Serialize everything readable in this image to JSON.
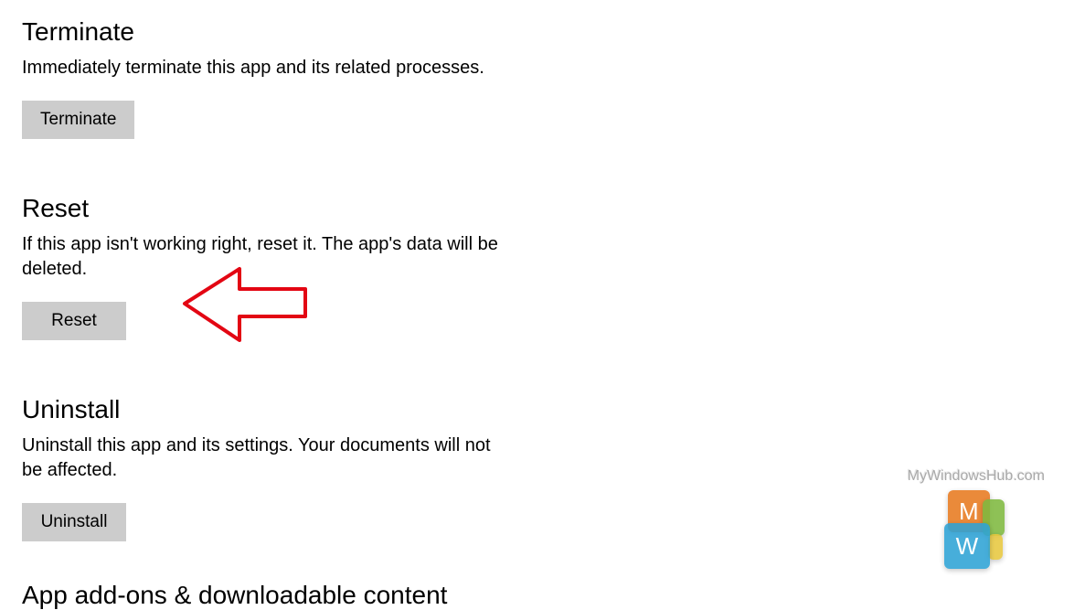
{
  "sections": {
    "terminate": {
      "heading": "Terminate",
      "description": "Immediately terminate this app and its related processes.",
      "button_label": "Terminate"
    },
    "reset": {
      "heading": "Reset",
      "description": "If this app isn't working right, reset it. The app's data will be deleted.",
      "button_label": "Reset"
    },
    "uninstall": {
      "heading": "Uninstall",
      "description": "Uninstall this app and its settings. Your documents will not be affected.",
      "button_label": "Uninstall"
    }
  },
  "truncated_heading": "App add-ons & downloadable content",
  "watermark": {
    "text": "MyWindowsHub.com",
    "logo_letters": {
      "top": "M",
      "bottom": "W"
    }
  },
  "annotation": {
    "arrow_color": "#e30613"
  }
}
